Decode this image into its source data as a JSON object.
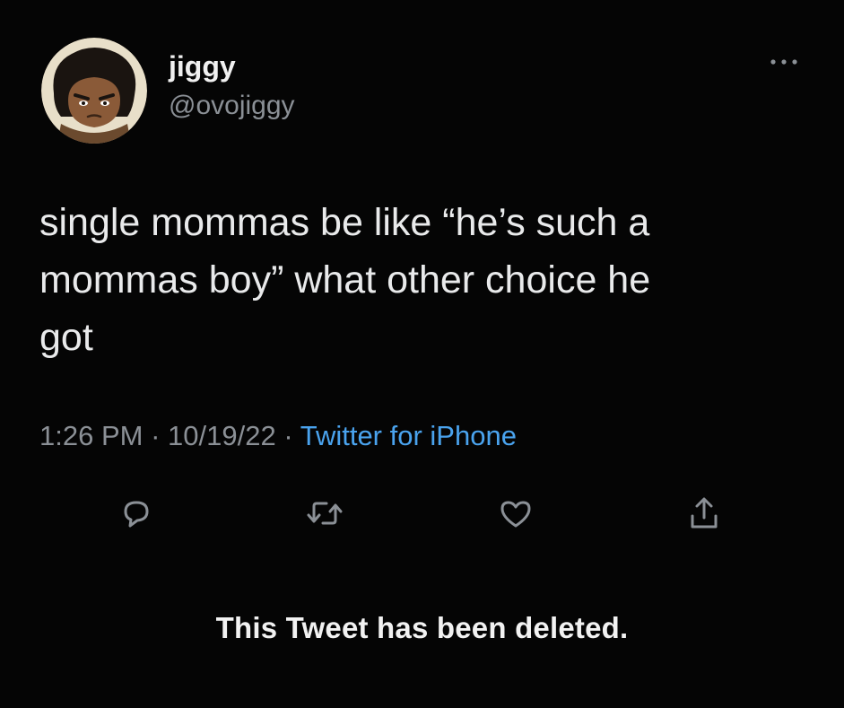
{
  "author": {
    "display_name": "jiggy",
    "handle": "@ovojiggy",
    "avatar_icon": "cartoon-avatar-icon"
  },
  "tweet": {
    "text": "single mommas be like “he’s such a\nmommas boy” what other choice he\ngot",
    "time": "1:26 PM",
    "separator": "·",
    "date": "10/19/22",
    "source": "Twitter for iPhone"
  },
  "actions": [
    {
      "name": "reply",
      "icon": "reply-bubble-icon"
    },
    {
      "name": "retweet",
      "icon": "retweet-icon"
    },
    {
      "name": "like",
      "icon": "heart-icon"
    },
    {
      "name": "share",
      "icon": "share-upload-icon"
    }
  ],
  "notice": {
    "text": "This Tweet has been deleted."
  },
  "colors": {
    "background": "#050505",
    "text": "#e9eaeb",
    "muted": "#8b9096",
    "link": "#4aa3ee"
  }
}
